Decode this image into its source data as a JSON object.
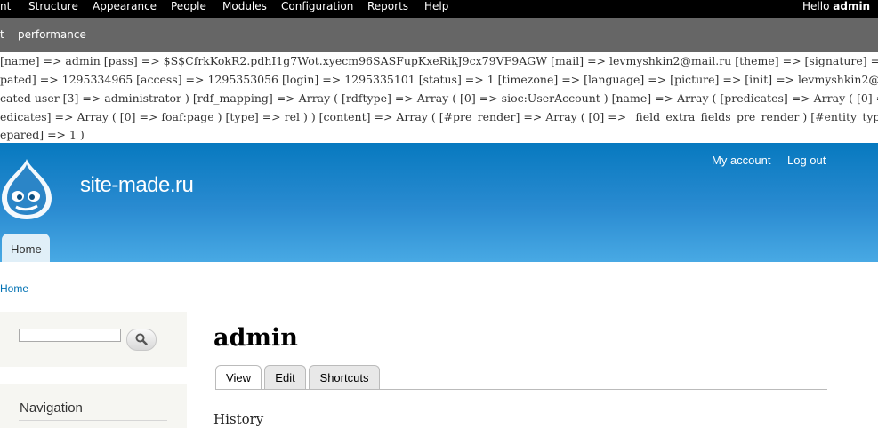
{
  "toolbar": {
    "menu": [
      "nt",
      "Structure",
      "Appearance",
      "People",
      "Modules",
      "Configuration",
      "Reports",
      "Help"
    ],
    "greeting": "Hello",
    "username": "admin"
  },
  "shortcuts": {
    "items": [
      "t",
      "performance"
    ]
  },
  "debug_lines": [
    "[name] => admin [pass] => $S$CfrkKokR2.pdhI1g7Wot.xyecm96SASFupKxeRikJ9cx79VF9AGW [mail] => levmyshkin2@mail.ru [theme] => [signature] =>",
    "pated] => 1295334965 [access] => 1295353056 [login] => 1295335101 [status] => 1 [timezone] => [language] => [picture] => [init] => levmyshkin2@mail.ru [d",
    "cated user [3] => administrator ) [rdf_mapping] => Array ( [rdftype] => Array ( [0] => sioc:UserAccount ) [name] => Array ( [predicates] => Array ( [0] => foa",
    "edicates] => Array ( [0] => foaf:page ) [type] => rel ) ) [content] => Array ( [#pre_render] => Array ( [0] => _field_extra_fields_pre_render ) [#entity_type] =",
    "epared] => 1 )"
  ],
  "header": {
    "site_name": "site-made.ru",
    "secondary_menu": [
      "My account",
      "Log out"
    ],
    "main_menu": [
      "Home"
    ]
  },
  "breadcrumb": "Home",
  "sidebar": {
    "search": {
      "value": ""
    },
    "navigation_title": "Navigation"
  },
  "main": {
    "title": "admin",
    "tabs": [
      "View",
      "Edit",
      "Shortcuts"
    ],
    "active_tab": "View",
    "history_label": "History"
  },
  "colors": {
    "toolbar_bg": "#000000",
    "shortcuts_bg": "#666666",
    "header_gradient_top": "#0779bf",
    "header_gradient_bottom": "#48a9e4",
    "link": "#0071b3"
  }
}
